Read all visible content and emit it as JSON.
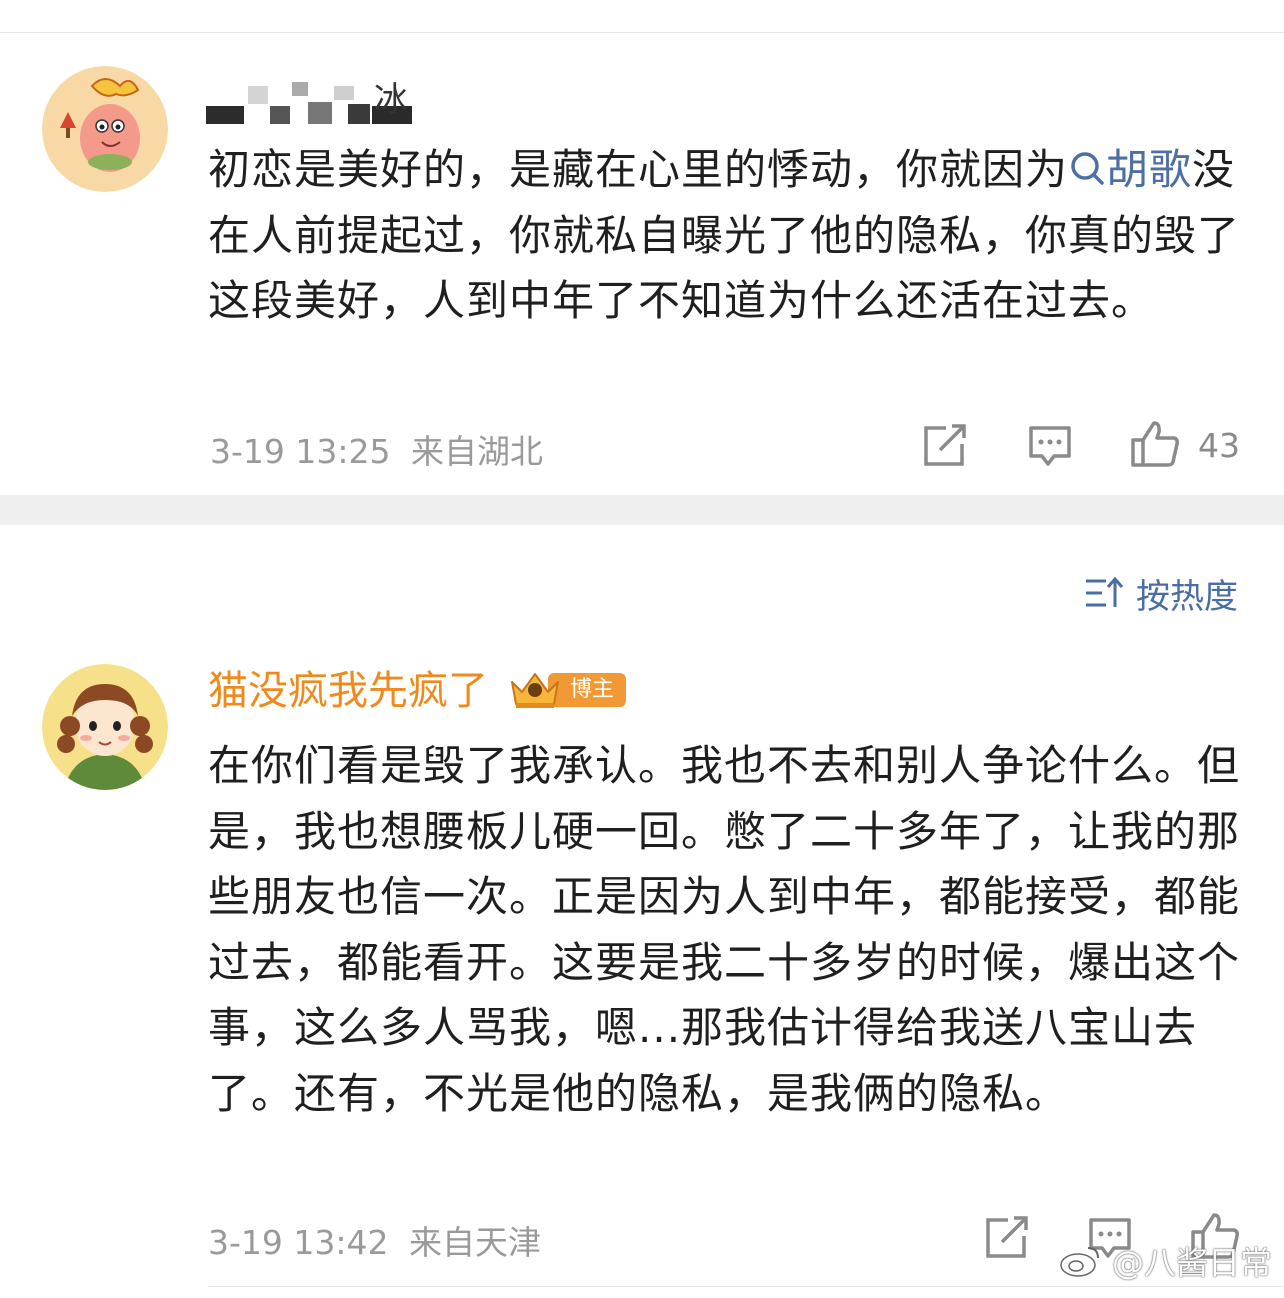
{
  "comment1": {
    "author_suffix": "冰",
    "text_part1": "初恋是美好的，是藏在心里的悸动，你就因为",
    "link_word": "胡歌",
    "text_part2": "没在人前提起过，你就私自曝光了他的隐私，你真的毁了这段美好，人到中年了不知道为什么还活在过去。",
    "timestamp": "3-19 13:25",
    "location": "来自湖北",
    "like_count": "43"
  },
  "sort": {
    "label": "按热度"
  },
  "comment2": {
    "author": "猫没疯我先疯了",
    "badge": "博主",
    "text": "在你们看是毁了我承认。我也不去和别人争论什么。但是，我也想腰板儿硬一回。憋了二十多年了，让我的那些朋友也信一次。正是因为人到中年，都能接受，都能过去，都能看开。这要是我二十多岁的时候，爆出这个事，这么多人骂我，嗯...那我估计得给我送八宝山去了。还有，不光是他的隐私，是我俩的隐私。",
    "timestamp": "3-19 13:42",
    "location": "来自天津"
  },
  "watermark": "@八酱日常",
  "colors": {
    "link": "#4e6fa3",
    "author_orange": "#f08a1c",
    "meta_gray": "#9a9a9a",
    "badge": "#f19a35"
  }
}
